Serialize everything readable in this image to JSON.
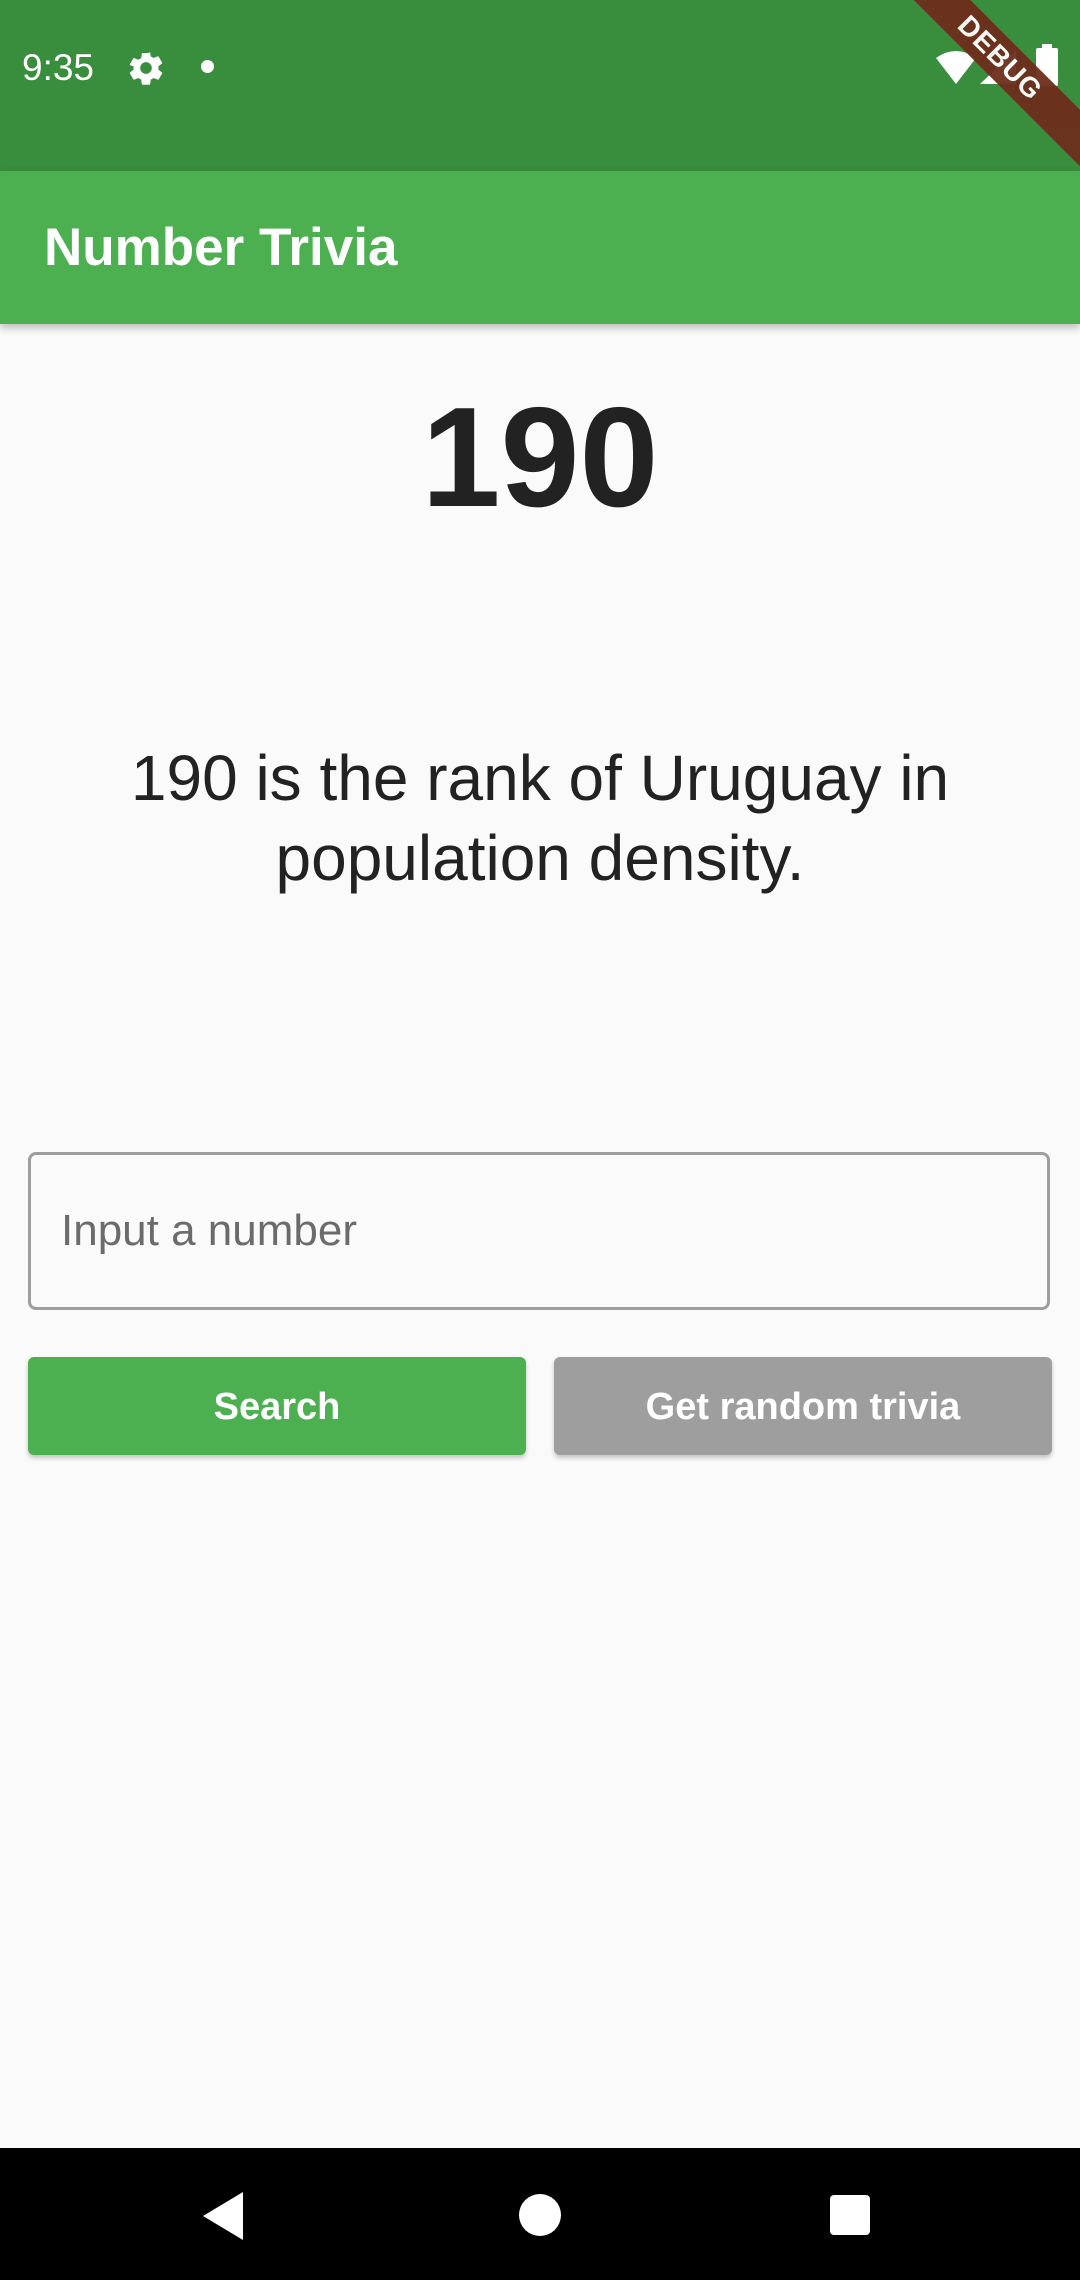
{
  "status_bar": {
    "time": "9:35",
    "debug_banner": "DEBUG",
    "icons": [
      "gear-icon",
      "notification-dot-icon",
      "wifi-icon",
      "signal-icon",
      "battery-icon"
    ]
  },
  "app_bar": {
    "title": "Number Trivia"
  },
  "trivia": {
    "number": "190",
    "text": "190 is the rank of Uruguay in population density."
  },
  "input": {
    "value": "",
    "placeholder": "Input a number"
  },
  "buttons": {
    "search_label": "Search",
    "random_label": "Get random trivia"
  },
  "nav_bar": {
    "icons": [
      "back-icon",
      "home-icon",
      "recents-icon"
    ]
  },
  "colors": {
    "status_bar": "#388e3c",
    "app_bar": "#4caf50",
    "search_button": "#4caf50",
    "random_button": "#9e9e9e",
    "background": "#fafafa"
  }
}
